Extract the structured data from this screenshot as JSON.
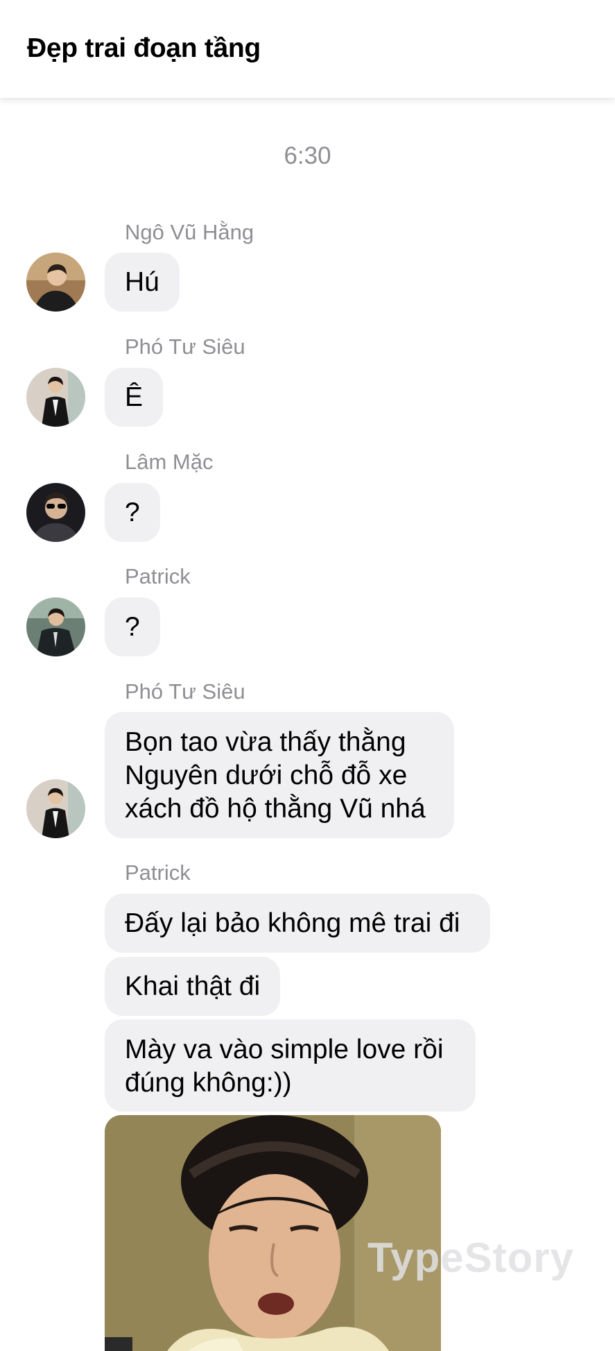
{
  "header": {
    "title": "Đẹp trai đoạn tầng"
  },
  "timestamp": "6:30",
  "messages": [
    {
      "sender": "Ngô Vũ Hằng",
      "lines": [
        "Hú"
      ]
    },
    {
      "sender": "Phó Tư Siêu",
      "lines": [
        "Ê"
      ]
    },
    {
      "sender": "Lâm Mặc",
      "lines": [
        "?"
      ]
    },
    {
      "sender": "Patrick",
      "lines": [
        "?"
      ]
    },
    {
      "sender": "Phó Tư Siêu",
      "lines": [
        "Bọn tao vừa thấy thằng",
        "Nguyên dưới chỗ đỗ xe",
        "xách đồ hộ thằng Vũ nhá"
      ]
    },
    {
      "sender": "Patrick",
      "lines": [
        "Đấy lại bảo không mê trai đi"
      ]
    },
    {
      "sender": "",
      "lines": [
        "Khai thật đi"
      ]
    },
    {
      "sender": "",
      "lines": [
        "Mày va vào simple love rồi",
        "đúng không:))"
      ]
    }
  ],
  "watermark": "TypeStory",
  "colors": {
    "bubble": "#f0f0f2",
    "meta_text": "#8e8e93",
    "header_bg": "#ffffff"
  }
}
